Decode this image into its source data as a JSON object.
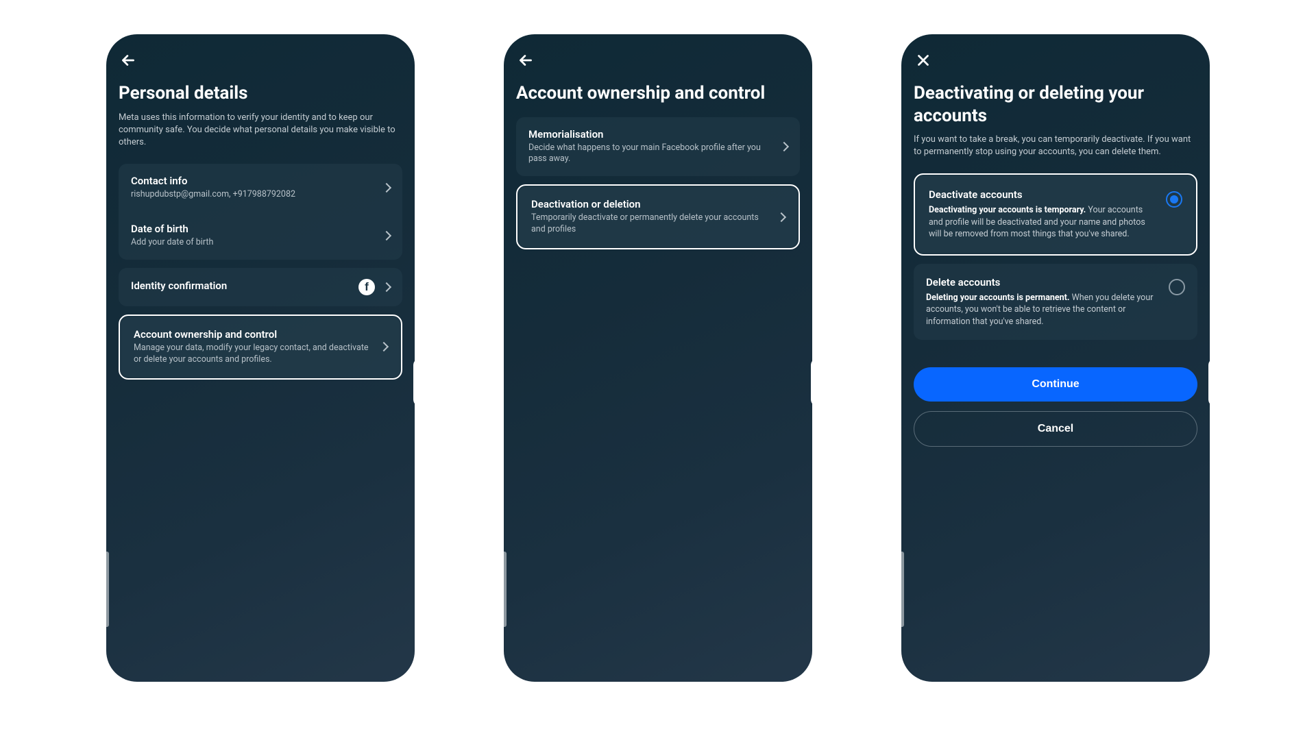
{
  "screen1": {
    "title": "Personal details",
    "subtitle": "Meta uses this information to verify your identity and to keep our community safe. You decide what personal details you make visible to others.",
    "items": {
      "contact": {
        "title": "Contact info",
        "sub": "rishupdubstp@gmail.com, +917988792082"
      },
      "dob": {
        "title": "Date of birth",
        "sub": "Add your date of birth"
      },
      "identity": {
        "title": "Identity confirmation"
      },
      "ownership": {
        "title": "Account ownership and control",
        "sub": "Manage your data, modify your legacy contact, and deactivate or delete your accounts and profiles."
      }
    }
  },
  "screen2": {
    "title": "Account ownership and control",
    "items": {
      "memorial": {
        "title": "Memorialisation",
        "sub": "Decide what happens to your main Facebook profile after you pass away."
      },
      "deactivation": {
        "title": "Deactivation or deletion",
        "sub": "Temporarily deactivate or permanently delete your accounts and profiles"
      }
    }
  },
  "screen3": {
    "title": "Deactivating or deleting your accounts",
    "subtitle": "If you want to take a break, you can temporarily deactivate. If you want to permanently stop using your accounts, you can delete them.",
    "deactivate": {
      "title": "Deactivate accounts",
      "bold": "Deactivating your accounts is temporary.",
      "rest": " Your accounts and profile will be deactivated and your name and photos will be removed from most things that you've shared."
    },
    "delete": {
      "title": "Delete accounts",
      "bold": "Deleting your accounts is permanent.",
      "rest": " When you delete your accounts, you won't be able to retrieve the content or information that you've shared."
    },
    "continue_label": "Continue",
    "cancel_label": "Cancel"
  }
}
